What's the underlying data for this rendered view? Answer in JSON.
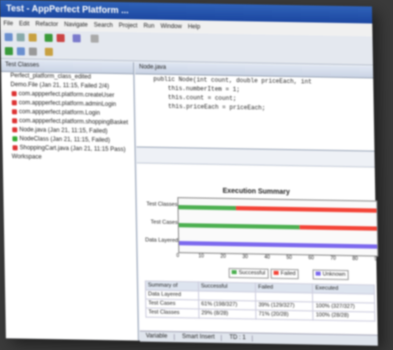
{
  "window": {
    "title": "Test - AppPerfect Platform ...",
    "menu": [
      "File",
      "Edit",
      "Refactor",
      "Navigate",
      "Search",
      "Project",
      "Run",
      "Window",
      "Help"
    ]
  },
  "left_pane": {
    "header": "Test Classes",
    "items": [
      {
        "label": "Perfect_platform_class_edited",
        "color": "#ffffff"
      },
      {
        "label": "Demo.File (Jan 21, 11:15, Failed 2/4)",
        "color": "#ffffff"
      },
      {
        "label": "com.appperfect.platform.createUser",
        "color": "#d33"
      },
      {
        "label": "com.appperfect.platform.adminLogin",
        "color": "#d33"
      },
      {
        "label": "com.appperfect.platform.Login",
        "color": "#d33"
      },
      {
        "label": "com.appperfect.platform.shoppingBasket",
        "color": "#d33"
      },
      {
        "label": "Node.java (Jan 21, 11:15, Failed)",
        "color": "#d33"
      },
      {
        "label": "NodeClass (Jan 21, 11:15, Failed)",
        "color": "#3a3"
      },
      {
        "label": "ShoppingCart.java (Jan 21, 11:15 Pass)",
        "color": "#d33"
      },
      {
        "label": "Workspace",
        "color": "#ffffff"
      }
    ]
  },
  "editor": {
    "tab": "Node.java",
    "lines": [
      "public Node(int count, double priceEach, int",
      "",
      "    this.numberItem = 1;",
      "    this.count = count;",
      "    this.priceEach = priceEach;"
    ]
  },
  "report": {
    "chart_title": "Execution Summary",
    "legend": [
      "Successful",
      "Failed",
      "Unknown"
    ],
    "colors": {
      "successful": "#4caf50",
      "failed": "#f44336",
      "unknown": "#7b68ee"
    },
    "table": {
      "headers": [
        "Summary of",
        "Successful",
        "Failed",
        "Executed"
      ],
      "rows": [
        [
          "Data Layered",
          "",
          "",
          ""
        ],
        [
          "Test Cases",
          "61% (198/327)",
          "39% (129/327)",
          "100% (327/327)"
        ],
        [
          "Test Classes",
          "29% (8/28)",
          "71% (20/28)",
          "100% (28/28)"
        ]
      ]
    }
  },
  "chart_data": {
    "type": "bar",
    "orientation": "horizontal",
    "title": "Execution Summary",
    "categories": [
      "Test Classes",
      "Test Cases",
      "Data Layered"
    ],
    "series": [
      {
        "name": "Successful",
        "values": [
          29,
          61,
          0
        ]
      },
      {
        "name": "Failed",
        "values": [
          71,
          39,
          0
        ]
      },
      {
        "name": "Unknown",
        "values": [
          0,
          0,
          100
        ]
      }
    ],
    "xlim": [
      0,
      100
    ],
    "xticks": [
      "0",
      "10",
      "20",
      "30",
      "40",
      "50",
      "60",
      "70",
      "80",
      "90"
    ]
  },
  "status": {
    "left": "Variable",
    "mid": "Smart Insert",
    "right": "TD : 1"
  }
}
